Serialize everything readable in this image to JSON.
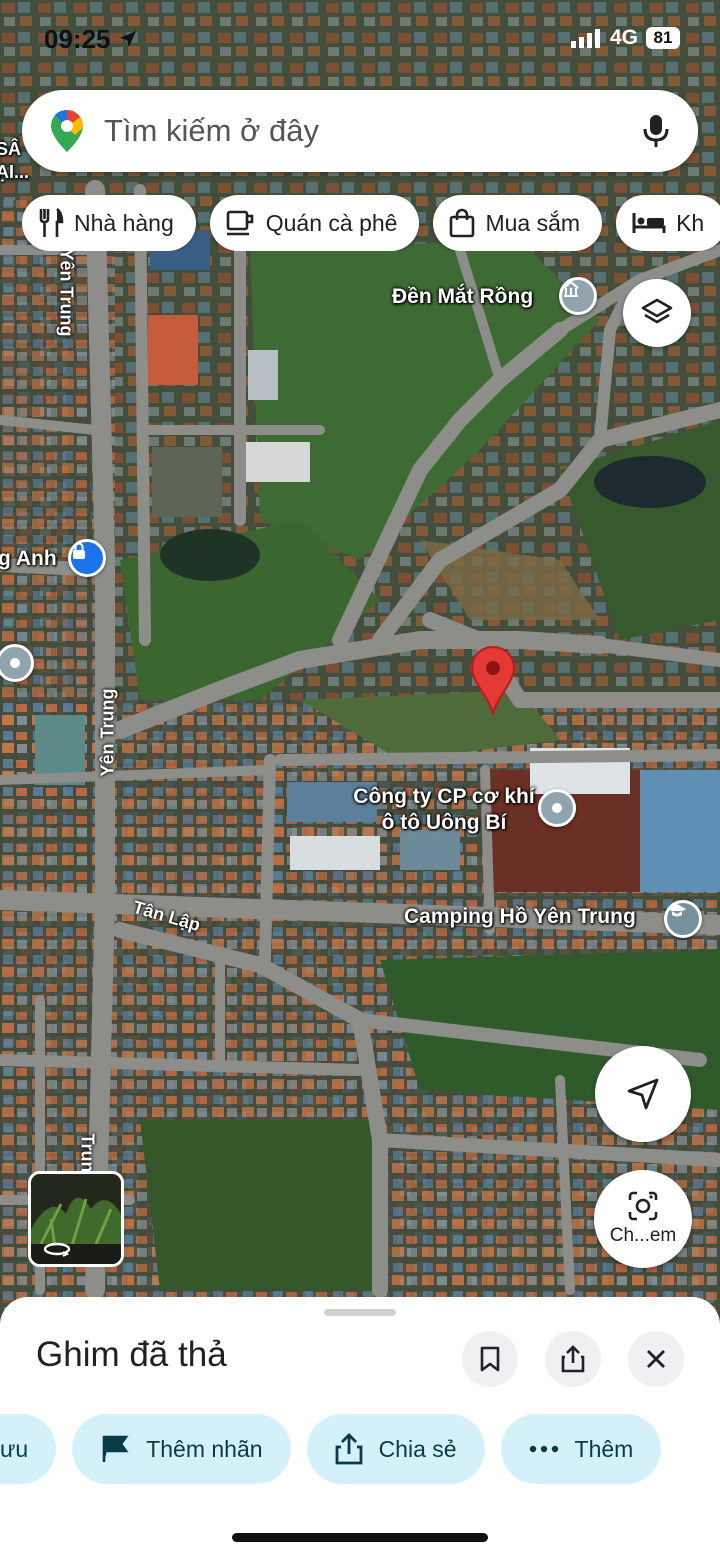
{
  "status_bar": {
    "time": "09:25",
    "network": "4G",
    "battery": "81"
  },
  "search": {
    "placeholder": "Tìm kiếm ở đây"
  },
  "chips": [
    {
      "label": "Nhà hàng",
      "icon": "restaurant-icon"
    },
    {
      "label": "Quán cà phê",
      "icon": "coffee-icon"
    },
    {
      "label": "Mua sắm",
      "icon": "shopping-bag-icon"
    },
    {
      "label": "Kh",
      "icon": "bed-icon"
    }
  ],
  "map": {
    "places": [
      {
        "name": "Đền Mắt Rồng"
      },
      {
        "name": "Công ty CP cơ khí ô tô Uông Bí"
      },
      {
        "name": "Camping Hồ Yên Trung"
      },
      {
        "name": "g Anh"
      },
      {
        "name": "SÂ ẠI..."
      }
    ],
    "roads": [
      {
        "name": "Yên Trung"
      },
      {
        "name": "Yên Trung"
      },
      {
        "name": "Tân Lập"
      },
      {
        "name": "Trung"
      }
    ],
    "pin_color": "#e53935"
  },
  "camera_button": {
    "label": "Ch...em"
  },
  "sheet": {
    "title": "Ghim đã thả",
    "actions": [
      {
        "label": "ưu"
      },
      {
        "label": "Thêm nhãn"
      },
      {
        "label": "Chia sẻ"
      },
      {
        "label": "Thêm"
      }
    ]
  },
  "colors": {
    "accent": "#d4f1fa",
    "road": "#8c8c8c",
    "pin": "#e53935",
    "poi_blue": "#1a73e8",
    "poi_gray": "#78909c"
  }
}
